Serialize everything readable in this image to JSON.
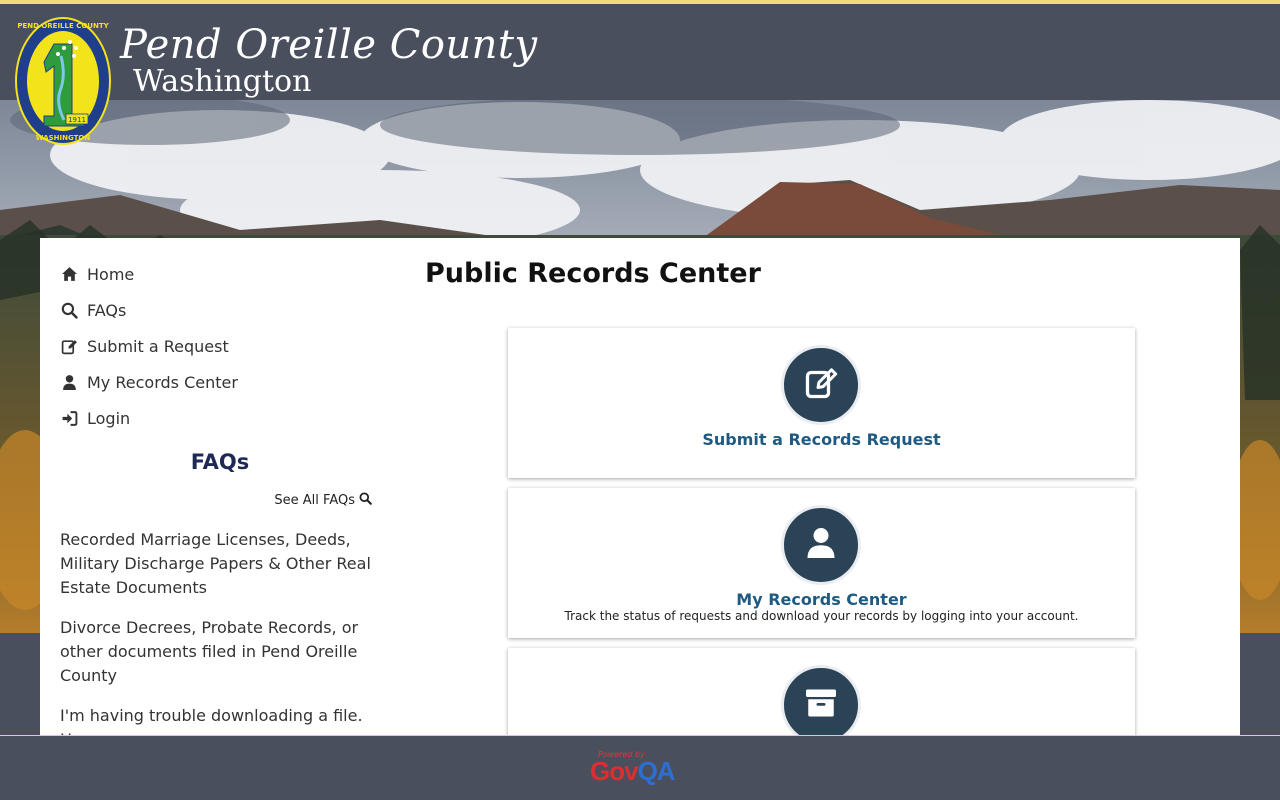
{
  "header": {
    "brand_script": "Pend Oreille County",
    "brand_sub": "Washington",
    "logo": {
      "ring_text": "PEND OREILLE COUNTY",
      "bottom_text": "WASHINGTON",
      "year": "1911",
      "colors": {
        "ring": "#1f3f8c",
        "inner": "#f3e31a",
        "green": "#2e9b3c"
      }
    }
  },
  "nav": {
    "items": [
      {
        "label": "Home",
        "icon": "home-icon"
      },
      {
        "label": "FAQs",
        "icon": "search-icon"
      },
      {
        "label": "Submit a Request",
        "icon": "edit-icon"
      },
      {
        "label": "My Records Center",
        "icon": "user-icon"
      },
      {
        "label": "Login",
        "icon": "sign-in-icon"
      }
    ]
  },
  "faqs": {
    "title": "FAQs",
    "see_all": "See All FAQs",
    "items": [
      "Recorded Marriage Licenses, Deeds, Military Discharge Papers & Other Real Estate Documents",
      "Divorce Decrees, Probate Records, or other documents filed in Pend Oreille County",
      "I'm having trouble downloading a file. How"
    ]
  },
  "main": {
    "title": "Public Records Center",
    "tiles": [
      {
        "title": "Submit a Records Request",
        "description": "",
        "icon": "edit-icon"
      },
      {
        "title": "My Records Center",
        "description": "Track the status of requests and download your records by logging into your account.",
        "icon": "user-icon"
      },
      {
        "title": "",
        "description": "",
        "icon": "archive-icon"
      }
    ]
  },
  "footer": {
    "powered_by": "Powered by",
    "brand_gov": "Gov",
    "brand_qa": "QA"
  },
  "colors": {
    "header_bg": "#4a4f5e",
    "accent": "#f2dc7a",
    "tile_circle": "#2b4357",
    "tile_title": "#1f5a82",
    "faq_title": "#1e2a55"
  }
}
